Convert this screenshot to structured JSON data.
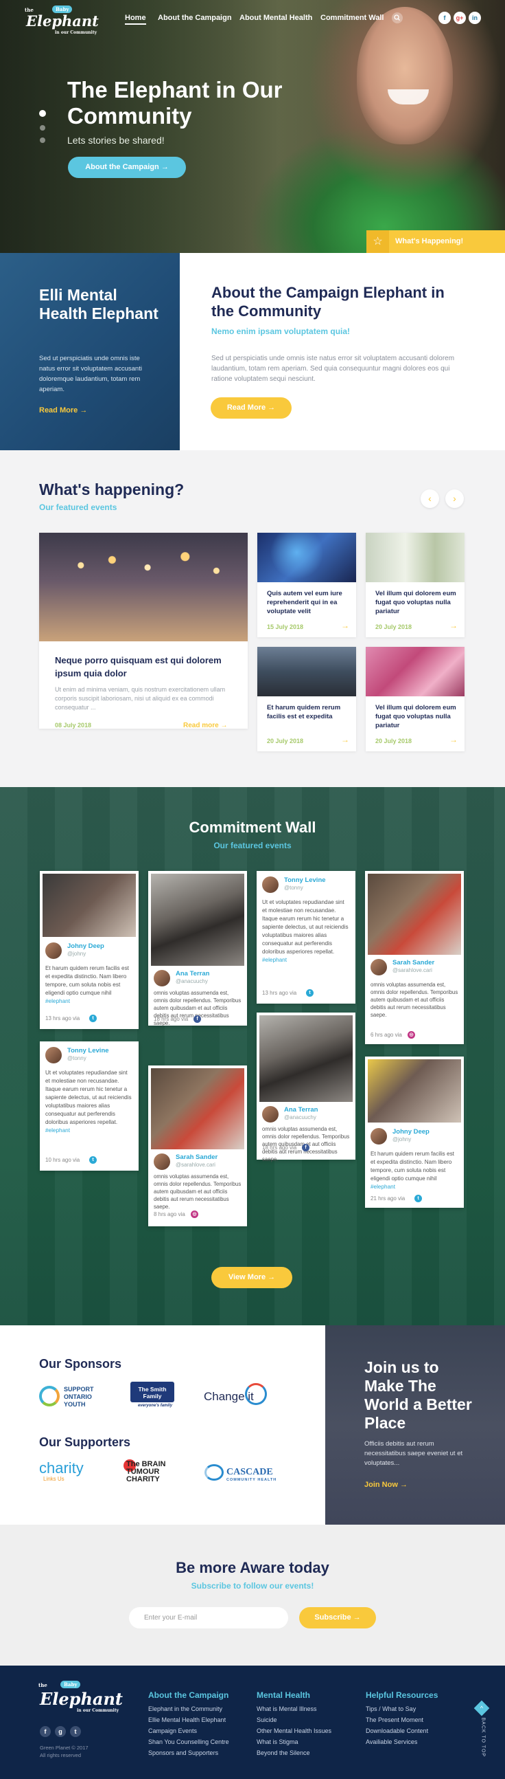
{
  "brand": {
    "name": "Elephant",
    "small_top": "the",
    "small_badge": "Baby",
    "small_bottom": "in our Community"
  },
  "nav": {
    "items": [
      "Home",
      "About the Campaign",
      "About Mental Health",
      "Commitment Wall"
    ],
    "search_icon": "search-icon",
    "social": [
      "f",
      "g+",
      "in"
    ]
  },
  "hero": {
    "title": "The Elephant in Our Community",
    "subtitle": "Lets stories be shared!",
    "cta": "About the Campaign",
    "happening_tab": "What's Happening!",
    "slides": 3,
    "active_slide": 0
  },
  "elli": {
    "title": "Elli Mental Health Elephant",
    "text": "Sed ut perspiciatis unde omnis iste natus error sit voluptatem accusanti doloremque laudantium, totam rem aperiam.",
    "cta": "Read More"
  },
  "about": {
    "title": "About the Campaign Elephant in the Community",
    "tagline": "Nemo enim ipsam voluptatem quia!",
    "text": "Sed ut perspiciatis unde omnis iste natus error sit voluptatem accusanti dolorem laudantium, totam rem aperiam. Sed quia consequuntur magni dolores eos qui ratione voluptatem sequi nesciunt.",
    "cta": "Read More"
  },
  "happening": {
    "title": "What's happening?",
    "subtitle": "Our featured events",
    "featured": {
      "title": "Neque porro quisquam est qui dolorem ipsum quia dolor",
      "text": "Ut enim ad minima veniam, quis nostrum exercitationem ullam corporis suscipit laboriosam, nisi ut aliquid ex ea commodi consequatur ...",
      "date": "08 July 2018",
      "cta": "Read more"
    },
    "cards": [
      {
        "title": "Quis autem vel eum iure reprehenderit qui in ea voluptate velit",
        "date": "15 July 2018"
      },
      {
        "title": "Vel illum qui dolorem eum fugat quo voluptas nulla pariatur",
        "date": "20 July 2018"
      },
      {
        "title": "Et harum quidem rerum facilis est et expedita",
        "date": "20 July 2018"
      },
      {
        "title": "Vel illum qui dolorem eum fugat quo voluptas nulla pariatur",
        "date": "20 July 2018"
      }
    ]
  },
  "commit": {
    "title": "Commitment Wall",
    "subtitle": "Our featured events",
    "cta": "View More",
    "posts": [
      {
        "name": "Johny Deep",
        "handle": "@johny",
        "text": "Et harum quidem rerum facilis est et expedita distinctio. Nam libero tempore, cum soluta nobis est eligendi optio cumque nihil",
        "tag": "#elephant",
        "time": "13 hrs ago via"
      },
      {
        "name": "Tonny Levine",
        "handle": "@tonny",
        "text": "Ut et voluptates repudiandae sint et molestiae non recusandae. Itaque earum rerum hic tenetur a sapiente delectus, ut aut reiciendis voluptatibus maiores alias consequatur aut perferendis doloribus asperiores repellat.",
        "tag": "#elephant",
        "time": "10 hrs ago via"
      },
      {
        "name": "Ana Terran",
        "handle": "@anacuuchy",
        "text": "omnis voluptas assumenda est, omnis dolor repellendus. Temporibus autem quibusdam et aut officiis debitis aut rerum necessitatibus saepe.",
        "tag": "",
        "time": "18 hrs ago via"
      },
      {
        "name": "Sarah Sander",
        "handle": "@sarahlove.cari",
        "text": "omnis voluptas assumenda est, omnis dolor repellendus. Temporibus autem quibusdam et aut officiis debitis aut rerum necessitatibus saepe.",
        "tag": "",
        "time": "6 hrs ago via"
      },
      {
        "name": "Tonny Levine",
        "handle": "@tonny",
        "text": "Ut et voluptates repudiandae sint et molestiae non recusandae. Itaque earum rerum hic tenetur a sapiente delectus, ut aut reiciendis voluptatibus maiores alias consequatur aut perferendis doloribus asperiores repellat.",
        "tag": "#elephant",
        "time": "13 hrs ago via"
      },
      {
        "name": "Ana Terran",
        "handle": "@anacuuchy",
        "text": "omnis voluptas assumenda est, omnis dolor repellendus. Temporibus autem quibusdam et aut officiis debitis aut rerum necessitatibus saepe.",
        "tag": "",
        "time": "18 hrs ago via"
      },
      {
        "name": "Sarah Sander",
        "handle": "@sarahlove.cari",
        "text": "omnis voluptas assumenda est, omnis dolor repellendus. Temporibus autem quibusdam et aut officiis debitis aut rerum necessitatibus saepe.",
        "tag": "",
        "time": "8 hrs ago via"
      },
      {
        "name": "Johny Deep",
        "handle": "@johny",
        "text": "Et harum quidem rerum facilis est et expedita distinctio. Nam libero tempore, cum soluta nobis est eligendi optio cumque nihil",
        "tag": "#elephant",
        "time": "21 hrs ago via"
      }
    ]
  },
  "sponsors": {
    "title": "Our Sponsors",
    "supporters_title": "Our Supporters",
    "sponsor_logos": [
      "SUPPORT ONTARIO YOUTH",
      "The Smith Family",
      "everyone's family",
      "Change it"
    ],
    "supporter_logos": [
      "charity",
      "Links Us",
      "The BRAIN TUMOUR CHARITY",
      "CASCADE",
      "COMMUNITY HEALTH"
    ]
  },
  "join": {
    "title": "Join us to Make The World a Better Place",
    "text": "Officiis debitis aut rerum necessitatibus saepe eveniet ut et voluptates...",
    "cta": "Join Now"
  },
  "aware": {
    "title": "Be more Aware today",
    "subtitle": "Subscribe to follow our events!",
    "placeholder": "Enter your E-mail",
    "cta": "Subscribe"
  },
  "footer": {
    "copyright": "Green Planet © 2017",
    "rights": "All rights reserved",
    "back_to_top": "BACK TO TOP",
    "cols": [
      {
        "title": "About the Campaign",
        "links": [
          "Elephant in the Community",
          "Ellie Mental Health Elephant",
          "Campaign Events",
          "Shan You Counselling Centre",
          "Sponsors and Supporters"
        ]
      },
      {
        "title": "Mental Health",
        "links": [
          "What is Mental Illness",
          "Suicide",
          "Other Mental Health Issues",
          "What is Stigma",
          "Beyond the Silence"
        ]
      },
      {
        "title": "Helpful Resources",
        "links": [
          "Tips / What to Say",
          "The Present Moment",
          "Downloadable Content",
          "Availiable Services"
        ]
      }
    ]
  },
  "colors": {
    "navy": "#1f2a55",
    "cyan": "#5bc6e0",
    "yellow": "#f9c93c",
    "green": "#a6c96a",
    "footer": "#0f2548"
  }
}
